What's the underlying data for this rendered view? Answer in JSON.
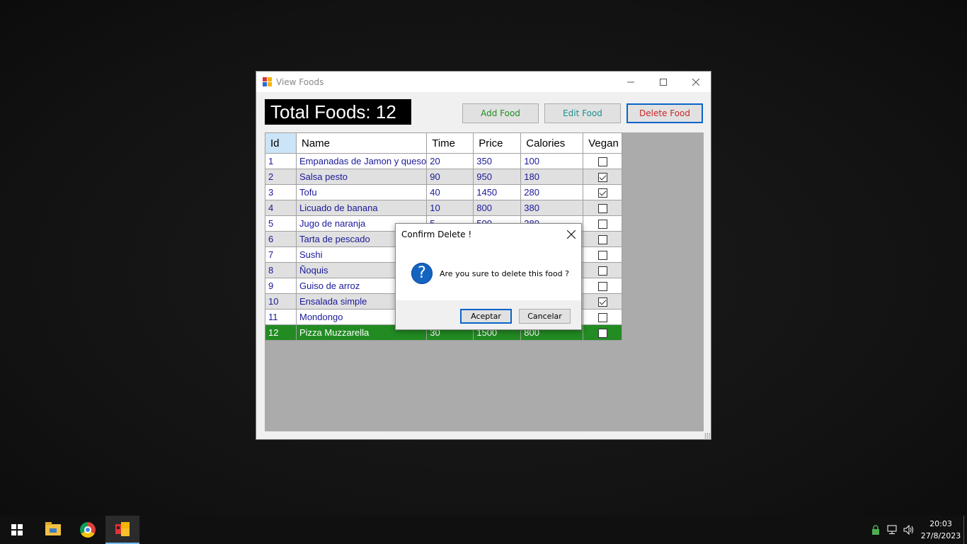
{
  "window": {
    "title": "View Foods",
    "total_label": "Total Foods: 12",
    "buttons": {
      "add": "Add Food",
      "edit": "Edit Food",
      "delete": "Delete Food"
    },
    "colors": {
      "add_text": "#228b22",
      "edit_text": "#1e8f8f",
      "delete_text": "#c62828",
      "selected_row": "#228b22"
    }
  },
  "grid": {
    "columns": [
      "Id",
      "Name",
      "Time",
      "Price",
      "Calories",
      "Vegan"
    ],
    "rows": [
      {
        "id": "1",
        "name": "Empanadas de Jamon y queso",
        "time": "20",
        "price": "350",
        "calories": "100",
        "vegan": false
      },
      {
        "id": "2",
        "name": "Salsa pesto",
        "time": "90",
        "price": "950",
        "calories": "180",
        "vegan": true
      },
      {
        "id": "3",
        "name": "Tofu",
        "time": "40",
        "price": "1450",
        "calories": "280",
        "vegan": true
      },
      {
        "id": "4",
        "name": "Licuado de banana",
        "time": "10",
        "price": "800",
        "calories": "380",
        "vegan": false
      },
      {
        "id": "5",
        "name": "Jugo de naranja",
        "time": "5",
        "price": "500",
        "calories": "380",
        "vegan": false
      },
      {
        "id": "6",
        "name": "Tarta de pescado",
        "time": "",
        "price": "",
        "calories": "",
        "vegan": false
      },
      {
        "id": "7",
        "name": "Sushi",
        "time": "",
        "price": "",
        "calories": "",
        "vegan": false
      },
      {
        "id": "8",
        "name": "Ñoquis",
        "time": "",
        "price": "",
        "calories": "",
        "vegan": false
      },
      {
        "id": "9",
        "name": "Guiso de arroz",
        "time": "",
        "price": "",
        "calories": "",
        "vegan": false
      },
      {
        "id": "10",
        "name": "Ensalada simple",
        "time": "",
        "price": "",
        "calories": "",
        "vegan": true
      },
      {
        "id": "11",
        "name": "Mondongo",
        "time": "",
        "price": "",
        "calories": "",
        "vegan": false
      },
      {
        "id": "12",
        "name": "Pizza Muzzarella",
        "time": "30",
        "price": "1500",
        "calories": "800",
        "vegan": false
      }
    ],
    "selected_row": 12
  },
  "dialog": {
    "title": "Confirm Delete !",
    "message": "Are you sure to delete this food ?",
    "icon": "question-icon",
    "ok_label": "Aceptar",
    "cancel_label": "Cancelar"
  },
  "taskbar": {
    "items": [
      "start-icon",
      "file-explorer-icon",
      "chrome-icon",
      "food-app-icon"
    ],
    "time": "20:03",
    "date": "27/8/2023"
  }
}
